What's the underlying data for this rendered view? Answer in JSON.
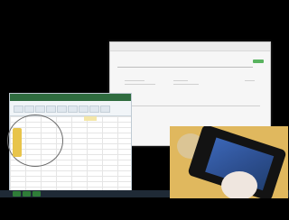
{
  "scene": {
    "colors": {
      "background": "#000000",
      "window_bg": "#f6f6f6",
      "spreadsheet_title": "#2f6c3f",
      "taskbar": "#1f2a36",
      "accent_green": "#59b35f"
    }
  }
}
